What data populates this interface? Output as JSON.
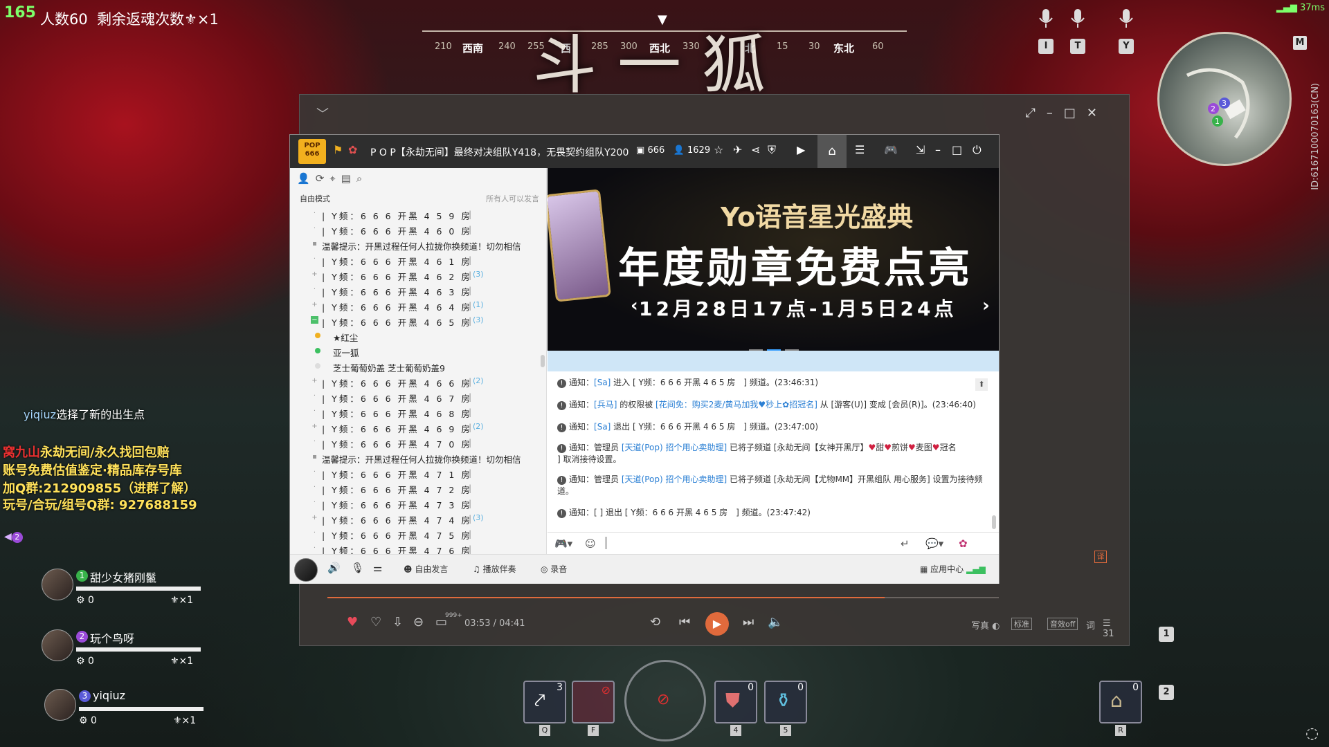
{
  "hud": {
    "fps": "165",
    "players": "人数60",
    "revives": "剩余返魂次数⚜×1",
    "ping": "37ms",
    "boss_name": "斗一狐",
    "map_id": "ID:6167100070163(CN)",
    "map_key": "M",
    "compass": {
      "ticks": [
        "210",
        "240",
        "255",
        "285",
        "300",
        "330",
        "15",
        "30",
        "60"
      ],
      "dirs": [
        "西南",
        "西",
        "西北",
        "北",
        "东北"
      ]
    },
    "mic_keys": [
      "I",
      "T",
      "Y"
    ]
  },
  "chat": {
    "system_name": "yiqiuz",
    "system_msg": "选择了新的出生点",
    "ads": [
      "永劫无间/永久找回包赔",
      "账号免费估值鉴定·精品库存号库",
      "加Q群:212909855（进群了解）",
      "玩号/合玩/组号Q群: 927688159"
    ],
    "ad_prefix": "窝九山"
  },
  "team": {
    "marker": "2",
    "members": [
      {
        "num": "1",
        "name": "甜少女猪刚鬣",
        "stat": "0",
        "revive": "⚜×1",
        "color": "#38b24a"
      },
      {
        "num": "2",
        "name": "玩个鸟呀",
        "stat": "0",
        "revive": "⚜×1",
        "color": "#9a4ad8"
      },
      {
        "num": "3",
        "name": "yiqiuz",
        "stat": "0",
        "revive": "⚜×1",
        "color": "#5a5ad8"
      }
    ]
  },
  "yy": {
    "logo": "POP 666",
    "title": "P O P【永劫无间】最终对决组队Y418，无畏契约组队Y200",
    "room_id": "666",
    "online": "1629",
    "mode": "自由模式",
    "mode_note": "所有人可以发言",
    "channels": [
      {
        "text": "| Y频：6 6 6 开黑 4 5 9 房",
        "count": "",
        "kind": "ch",
        "exp": "·"
      },
      {
        "text": "| Y频：6 6 6 开黑 4 6 0 房",
        "count": "",
        "kind": "ch",
        "exp": "·"
      },
      {
        "text": "温馨提示：开黑过程任何人拉拢你换频道！切勿相信",
        "count": "",
        "kind": "tip",
        "exp": "▪"
      },
      {
        "text": "| Y频：6 6 6 开黑 4 6 1 房",
        "count": "",
        "kind": "ch",
        "exp": "·"
      },
      {
        "text": "| Y频：6 6 6 开黑 4 6 2 房",
        "count": "(3)",
        "kind": "ch",
        "exp": "+"
      },
      {
        "text": "| Y频：6 6 6 开黑 4 6 3 房",
        "count": "",
        "kind": "ch",
        "exp": "·"
      },
      {
        "text": "| Y频：6 6 6 开黑 4 6 4 房",
        "count": "(1)",
        "kind": "ch",
        "exp": "+"
      },
      {
        "text": "| Y频：6 6 6 开黑 4 6 5 房",
        "count": "(3)",
        "kind": "ch",
        "exp": "−",
        "open": true
      },
      {
        "text": "★红尘",
        "count": "",
        "kind": "mem",
        "dot": "#f0b020"
      },
      {
        "text": "亚一狐",
        "count": "",
        "kind": "mem",
        "dot": "#3cc060"
      },
      {
        "text": "芝士葡萄奶盖  芝士葡萄奶盖9",
        "count": "",
        "kind": "mem",
        "dot": "#ddd"
      },
      {
        "text": "| Y频：6 6 6 开黑 4 6 6 房",
        "count": "(2)",
        "kind": "ch",
        "exp": "+"
      },
      {
        "text": "| Y频：6 6 6 开黑 4 6 7 房",
        "count": "",
        "kind": "ch",
        "exp": "·"
      },
      {
        "text": "| Y频：6 6 6 开黑 4 6 8 房",
        "count": "",
        "kind": "ch",
        "exp": "·"
      },
      {
        "text": "| Y频：6 6 6 开黑 4 6 9 房",
        "count": "(2)",
        "kind": "ch",
        "exp": "+"
      },
      {
        "text": "| Y频：6 6 6 开黑 4 7 0 房",
        "count": "",
        "kind": "ch",
        "exp": "·"
      },
      {
        "text": "温馨提示：开黑过程任何人拉拢你换频道！切勿相信",
        "count": "",
        "kind": "tip",
        "exp": "▪"
      },
      {
        "text": "| Y频：6 6 6 开黑 4 7 1 房",
        "count": "",
        "kind": "ch",
        "exp": "·"
      },
      {
        "text": "| Y频：6 6 6 开黑 4 7 2 房",
        "count": "",
        "kind": "ch",
        "exp": "·"
      },
      {
        "text": "| Y频：6 6 6 开黑 4 7 3 房",
        "count": "",
        "kind": "ch",
        "exp": "·"
      },
      {
        "text": "| Y频：6 6 6 开黑 4 7 4 房",
        "count": "(3)",
        "kind": "ch",
        "exp": "+"
      },
      {
        "text": "| Y频：6 6 6 开黑 4 7 5 房",
        "count": "",
        "kind": "ch",
        "exp": "·"
      },
      {
        "text": "| Y频：6 6 6 开黑 4 7 6 房",
        "count": "",
        "kind": "ch",
        "exp": "·"
      }
    ],
    "banner": {
      "line1": "Yo语音星光盛典",
      "line2": "年度勋章免费点亮",
      "line3": "12月28日17点-1月5日24点"
    },
    "notices": [
      {
        "html": "通知：<span class='bl'>[Sa]</span> 进入 [ Y频：6 6 6 开黑 4 6 5 房　] 频道。(23:46:31)"
      },
      {
        "html": "通知：<span class='bl'>[兵马]</span> 的权限被 <span class='bl'>[花间免：购买2麦/黄马加我♥秒上✿招冠名]</span> 从 [游客(U)] 变成 [会员(R)]。(23:46:40)"
      },
      {
        "html": "通知：<span class='bl'>[Sa]</span> 退出 [ Y频：6 6 6 开黑 4 6 5 房　] 频道。(23:47:00)"
      },
      {
        "html": "通知：管理员 <span class='bl'>[天道(Pop)  招个用心卖助理]</span> 已将子频道 [永劫无间【女神开黑厅】<span class='hr'>♥</span>甜<span class='hr'>♥</span>煎饼<span class='hr'>♥</span>麦图<span class='hr'>♥</span>冠名<br>] 取消接待设置。"
      },
      {
        "html": "通知：管理员 <span class='bl'>[天道(Pop)  招个用心卖助理]</span> 已将子频道 [永劫无间【尤物MM】开黑组队  用心服务] 设置为接待频道。"
      },
      {
        "html": "通知：[ ] 退出 [ Y频：6 6 6 开黑 4 6 5 房　] 频道。(23:47:42)"
      }
    ],
    "bottom": {
      "free_speak": "自由发言",
      "accompany": "播放伴奏",
      "record": "录音",
      "app_center": "应用中心"
    }
  },
  "music": {
    "time": "03:53 / 04:41",
    "progress": 0.83,
    "comments": "999+",
    "realistic": "写真",
    "quality": "标准",
    "effect": "音效off",
    "lyrics": "词",
    "playlist_count": "31"
  },
  "skills": [
    {
      "key": "Q",
      "count": "3"
    },
    {
      "key": "F",
      "count": ""
    },
    {
      "key": "4",
      "count": "0"
    },
    {
      "key": "5",
      "count": "0"
    }
  ],
  "slots": {
    "r_key": "R",
    "r_count": "0",
    "slot1": "1",
    "slot2": "2"
  }
}
